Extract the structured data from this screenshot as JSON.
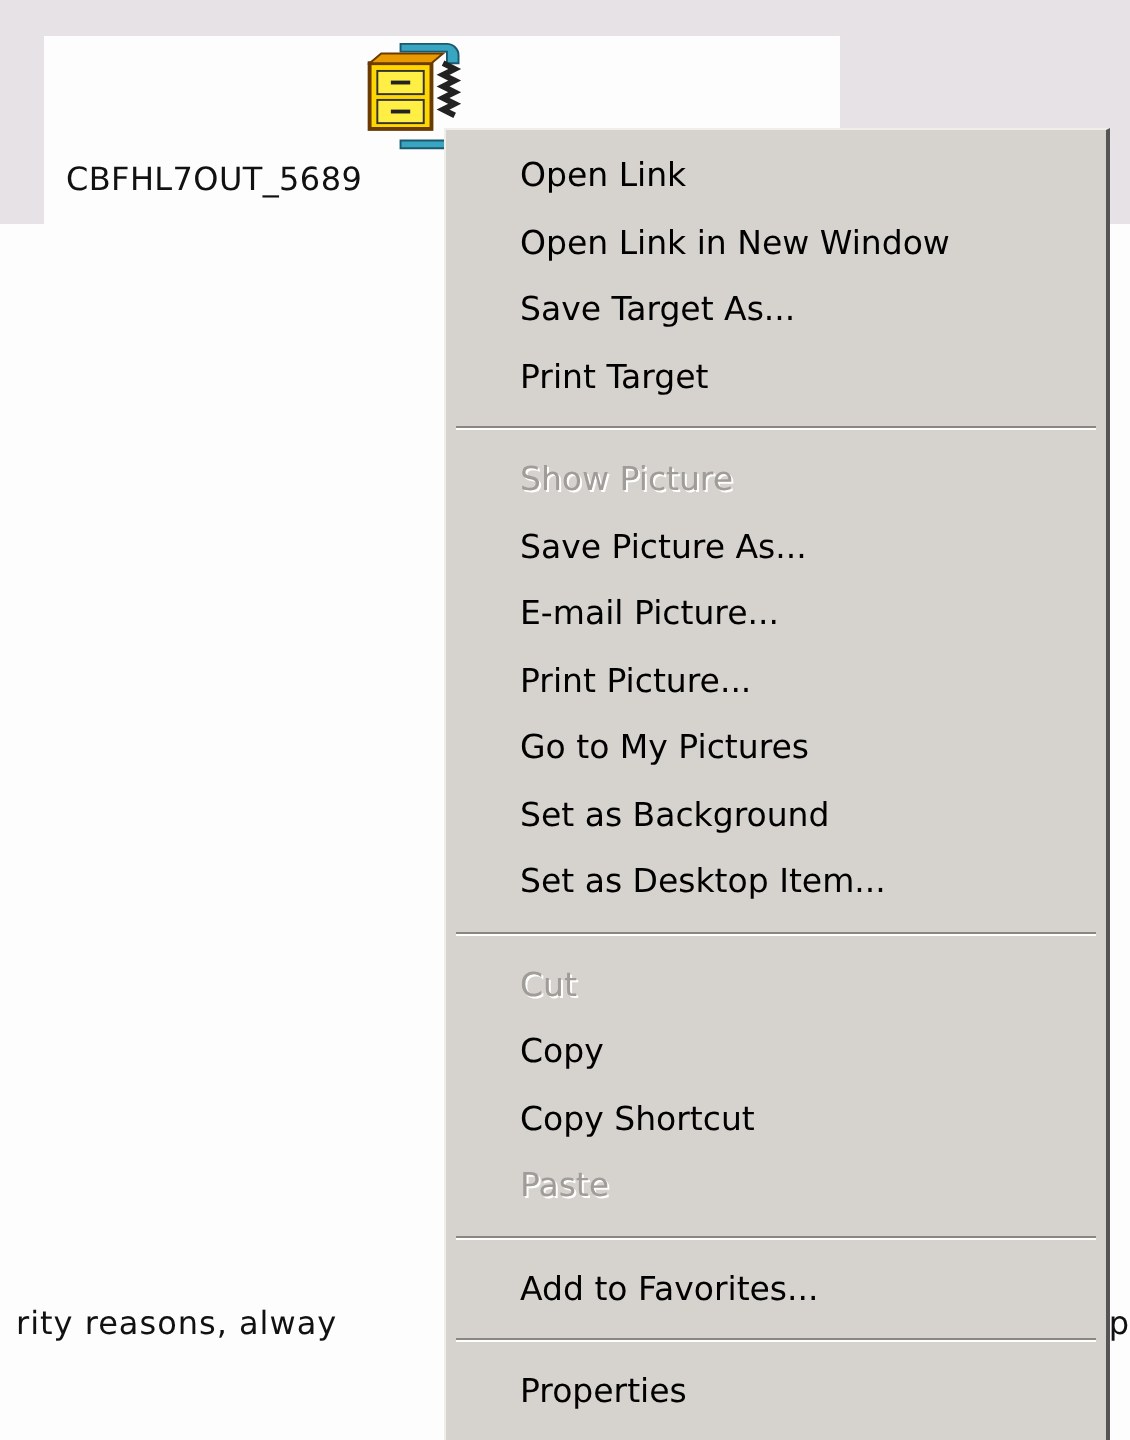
{
  "file_icon": {
    "label": "CBFHL7OUT_5689"
  },
  "body_text": {
    "left_fragment": "rity reasons, alway",
    "right_fragment": "p"
  },
  "context_menu": {
    "groups": [
      {
        "items": [
          {
            "label": "Open Link",
            "disabled": false
          },
          {
            "label": "Open Link in New Window",
            "disabled": false
          },
          {
            "label": "Save Target As...",
            "disabled": false
          },
          {
            "label": "Print Target",
            "disabled": false
          }
        ]
      },
      {
        "items": [
          {
            "label": "Show Picture",
            "disabled": true
          },
          {
            "label": "Save Picture As...",
            "disabled": false
          },
          {
            "label": "E-mail Picture...",
            "disabled": false
          },
          {
            "label": "Print Picture...",
            "disabled": false
          },
          {
            "label": "Go to My Pictures",
            "disabled": false
          },
          {
            "label": "Set as Background",
            "disabled": false
          },
          {
            "label": "Set as Desktop Item...",
            "disabled": false
          }
        ]
      },
      {
        "items": [
          {
            "label": "Cut",
            "disabled": true
          },
          {
            "label": "Copy",
            "disabled": false
          },
          {
            "label": "Copy Shortcut",
            "disabled": false
          },
          {
            "label": "Paste",
            "disabled": true
          }
        ]
      },
      {
        "items": [
          {
            "label": "Add to Favorites...",
            "disabled": false
          }
        ]
      },
      {
        "items": [
          {
            "label": "Properties",
            "disabled": false
          }
        ]
      }
    ]
  }
}
